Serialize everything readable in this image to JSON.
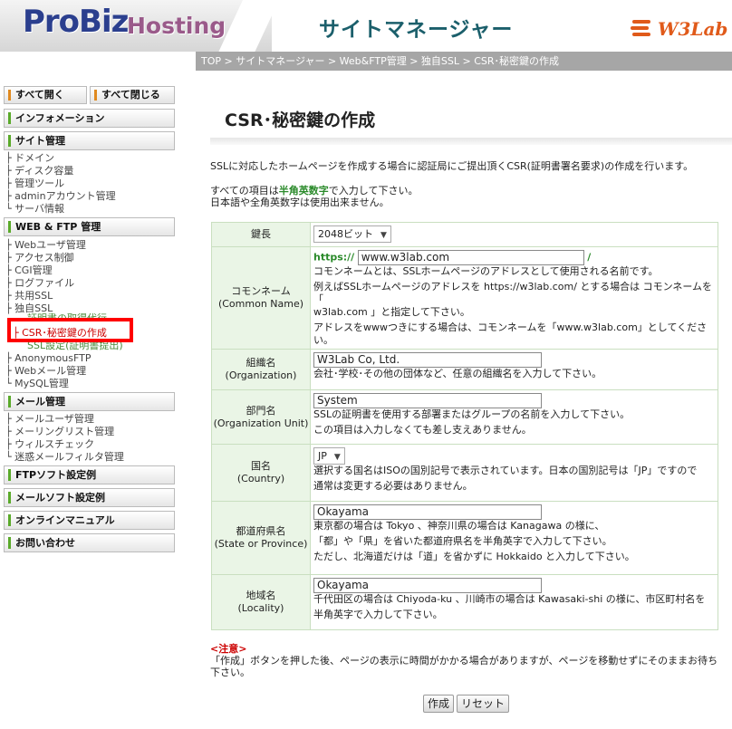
{
  "header": {
    "logo_pro": "ProBiz",
    "logo_host": "Hosting",
    "title": "サイトマネージャー",
    "w3lab": "W3Lab",
    "accent": "#2b3f8e"
  },
  "breadcrumb": "TOP > サイトマネージャー > Web&FTP管理 > 独自SSL > CSR･秘密鍵の作成",
  "sidebar": {
    "open_all": "すべて開く",
    "close_all": "すべて閉じる",
    "info": "インフォメーション",
    "site": "サイト管理",
    "site_items": [
      "├ ドメイン",
      "├ ディスク容量",
      "├ 管理ツール",
      "├ adminアカウント管理",
      "└ サーバ情報"
    ],
    "web": "WEB & FTP 管理",
    "web_items": [
      "├ Webユーザ管理",
      "├ アクセス制御",
      "├ CGI管理",
      "├ ログファイル",
      "├ 共用SSL",
      "├ 独自SSL"
    ],
    "web_hidden_item": "証明書の取得代行",
    "web_active_item": "├ CSR･秘密鍵の作成",
    "web_hidden_item2": "SSL設定(証明書提出)",
    "web_items2": [
      "├ AnonymousFTP",
      "├ Webメール管理",
      "└ MySQL管理"
    ],
    "mail": "メール管理",
    "mail_items": [
      "├ メールユーザ管理",
      "├ メーリングリスト管理",
      "├ ウィルスチェック",
      "└ 迷惑メールフィルタ管理"
    ],
    "ftp_soft": "FTPソフト設定例",
    "mail_soft": "メールソフト設定例",
    "manual": "オンラインマニュアル",
    "contact": "お問い合わせ"
  },
  "main": {
    "title": "CSR･秘密鍵の作成",
    "intro": "SSLに対応したホームページを作成する場合に認証局にご提出頂くCSR(証明書署名要求)の作成を行います。",
    "rule1_pre": "すべての項目は",
    "rule1_em": "半角英数字",
    "rule1_post": "で入力して下さい。",
    "rule2": "日本語や全角英数字は使用出来ません。"
  },
  "form": {
    "key_label": "鍵長",
    "key_value": "2048ビット",
    "cn_label1": "コモンネーム",
    "cn_label2": "(Common Name)",
    "cn_prefix": "https://",
    "cn_value": "www.w3lab.com",
    "cn_suffix": "/",
    "cn_help1": "コモンネームとは、SSLホームページのアドレスとして使用される名前です。",
    "cn_help2": "例えばSSLホームページのアドレスを https://w3lab.com/ とする場合は コモンネームを「",
    "cn_help3": "w3lab.com 」と指定して下さい。",
    "cn_help4": "アドレスをwwwつきにする場合は、コモンネームを「www.w3lab.com」としてください。",
    "org_label1": "組織名",
    "org_label2": "(Organization)",
    "org_value": "W3Lab Co, Ltd.",
    "org_help": "会社･学校･その他の団体など、任意の組織名を入力して下さい。",
    "ou_label1": "部門名",
    "ou_label2": "(Organization Unit)",
    "ou_value": "System",
    "ou_help1": "SSLの証明書を使用する部署またはグループの名前を入力して下さい。",
    "ou_help2": "この項目は入力しなくても差し支えありません。",
    "c_label1": "国名",
    "c_label2": "(Country)",
    "c_value": "JP",
    "c_help1": "選択する国名はISOの国別記号で表示されています。日本の国別記号は「JP」ですので",
    "c_help2": "通常は変更する必要はありません。",
    "st_label1": "都道府県名",
    "st_label2": "(State or Province)",
    "st_value": "Okayama",
    "st_help1": "東京都の場合は Tokyo 、神奈川県の場合は Kanagawa の様に、",
    "st_help2": "「都」や「県」を省いた都道府県名を半角英字で入力して下さい。",
    "st_help3": "ただし、北海道だけは「道」を省かずに Hokkaido と入力して下さい。",
    "l_label1": "地域名",
    "l_label2": "(Locality)",
    "l_value": "Okayama",
    "l_help1": "千代田区の場合は Chiyoda-ku 、川崎市の場合は Kawasaki-shi の様に、市区町村名を",
    "l_help2": "半角英字で入力して下さい。"
  },
  "note": {
    "title": "<注意>",
    "line1": "「作成」ボタンを押した後、ページの表示に時間がかかる場合がありますが、ページを移動せずにそのままお待ち",
    "line2": "下さい。"
  },
  "buttons": {
    "create": "作成",
    "reset": "リセット"
  }
}
